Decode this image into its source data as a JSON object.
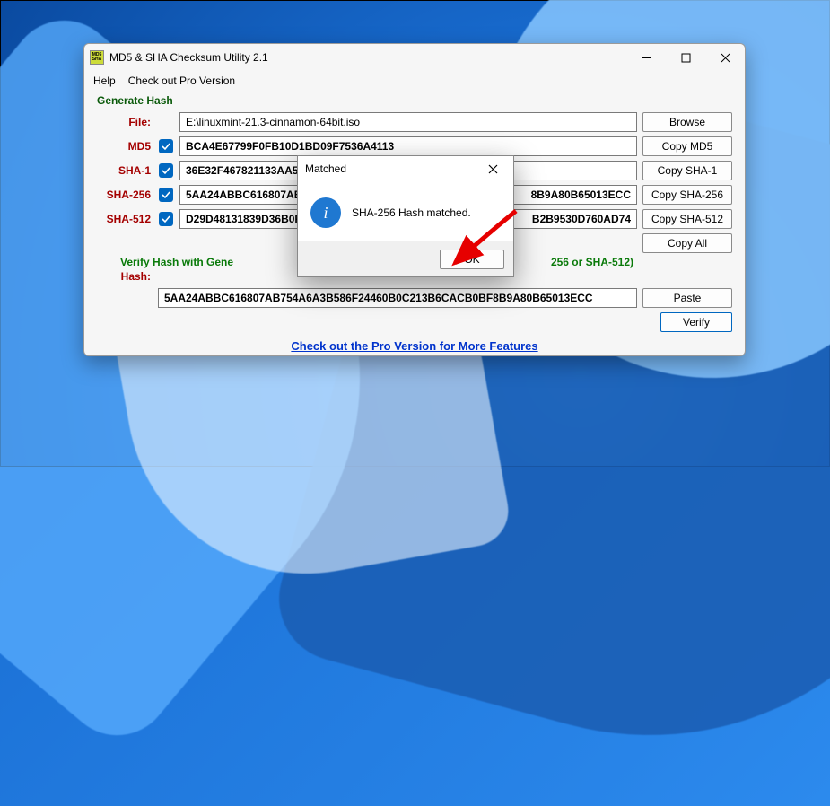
{
  "window": {
    "title": "MD5 & SHA Checksum Utility 2.1",
    "menu": {
      "help": "Help",
      "pro": "Check out Pro Version"
    },
    "section_title": "Generate Hash",
    "rows": {
      "file": {
        "label": "File:",
        "value": "E:\\linuxmint-21.3-cinnamon-64bit.iso",
        "button": "Browse"
      },
      "md5": {
        "label": "MD5",
        "value": "BCA4E67799F0FB10D1BD09F7536A4113",
        "button": "Copy MD5"
      },
      "sha1": {
        "label": "SHA-1",
        "value": "36E32F467821133AA581C",
        "button": "Copy SHA-1"
      },
      "sha256": {
        "label": "SHA-256",
        "value_left": "5AA24ABBC616807AB754",
        "value_right": "8B9A80B65013ECC",
        "button": "Copy SHA-256"
      },
      "sha512": {
        "label": "SHA-512",
        "value_left": "D29D48131839D36B0F2C",
        "value_right": "B2B9530D760AD74",
        "button": "Copy SHA-512"
      }
    },
    "copy_all": "Copy All",
    "verify_heading_left": "Verify Hash with Gene",
    "verify_heading_right": "256 or SHA-512)",
    "hash_row": {
      "label": "Hash:",
      "value": "5AA24ABBC616807AB754A6A3B586F24460B0C213B6CACB0BF8B9A80B65013ECC",
      "button": "Paste"
    },
    "verify_button": "Verify",
    "pro_link": "Check out the Pro Version for More Features"
  },
  "dialog": {
    "title": "Matched",
    "body": "SHA-256 Hash matched.",
    "ok": "OK"
  }
}
